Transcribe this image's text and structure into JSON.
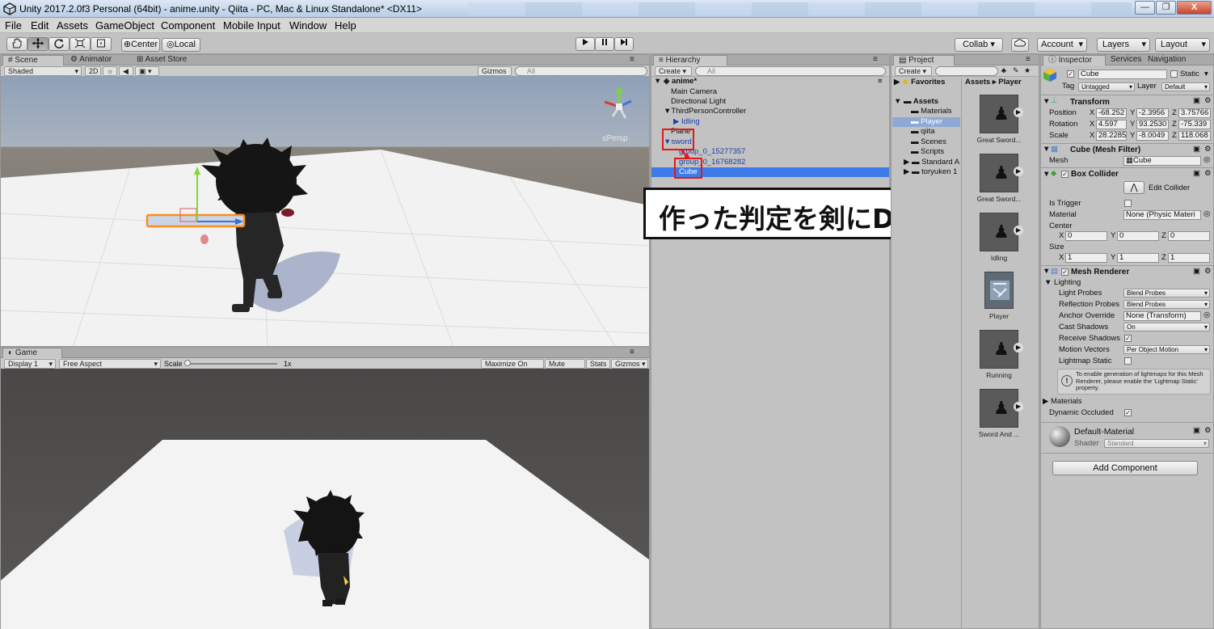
{
  "window": {
    "title": "Unity 2017.2.0f3 Personal (64bit) - anime.unity - Qiita - PC, Mac & Linux Standalone* <DX11>",
    "minimize": "—",
    "maximize": "❐",
    "close": "X"
  },
  "menu": [
    "File",
    "Edit",
    "Assets",
    "GameObject",
    "Component",
    "Mobile Input",
    "Window",
    "Help"
  ],
  "toolbar": {
    "pivot": "Center",
    "space": "Local",
    "collab": "Collab ▾",
    "account": "Account",
    "layers": "Layers",
    "layout": "Layout"
  },
  "scene": {
    "tabs": [
      "Scene",
      "Animator",
      "Asset Store"
    ],
    "shading": "Shaded",
    "mode_2d": "2D",
    "gizmos": "Gizmos",
    "search_placeholder": "All",
    "persp": "Persp"
  },
  "game": {
    "tab": "Game",
    "display": "Display 1",
    "aspect": "Free Aspect",
    "scale_label": "Scale",
    "scale_value": "1x",
    "maximize": "Maximize On Play",
    "mute": "Mute Audio",
    "stats": "Stats",
    "gizmos": "Gizmos"
  },
  "hierarchy": {
    "tab": "Hierarchy",
    "create": "Create",
    "search_placeholder": "All",
    "rows": [
      {
        "label": "anime*",
        "indent": 0,
        "style": "scene"
      },
      {
        "label": "Main Camera",
        "indent": 1,
        "style": "normal"
      },
      {
        "label": "Directional Light",
        "indent": 1,
        "style": "normal"
      },
      {
        "label": "ThirdPersonController",
        "indent": 1,
        "style": "normal"
      },
      {
        "label": "Idling",
        "indent": 2,
        "style": "blue"
      },
      {
        "label": "Plane",
        "indent": 1,
        "style": "normal"
      },
      {
        "label": "sword",
        "indent": 1,
        "style": "blue"
      },
      {
        "label": "group_0_15277357",
        "indent": 2,
        "style": "blue"
      },
      {
        "label": "group_0_16768282",
        "indent": 2,
        "style": "blue"
      },
      {
        "label": "Cube",
        "indent": 2,
        "style": "selected"
      }
    ]
  },
  "annotation": "作った判定を剣にD&D",
  "project": {
    "tab": "Project",
    "create": "Create",
    "favorites": "Favorites",
    "assets_root": "Assets",
    "breadcrumb_assets": "Assets",
    "breadcrumb_sep": "▸",
    "breadcrumb_current": "Player",
    "folders": [
      "Materials",
      "Player",
      "qiita",
      "Scenes",
      "Scripts",
      "Standard A",
      "toryuken 1"
    ],
    "assets": [
      "Great Sword...",
      "Great Sword...",
      "Idling",
      "Player",
      "Running",
      "Sword And ..."
    ]
  },
  "inspector": {
    "tabs": [
      "Inspector",
      "Services",
      "Navigation"
    ],
    "object_name": "Cube",
    "static_label": "Static",
    "tag_label": "Tag",
    "tag_value": "Untagged",
    "layer_label": "Layer",
    "layer_value": "Default",
    "transform": {
      "title": "Transform",
      "position_label": "Position",
      "position": [
        "-68.252",
        "-2.3956",
        "3.75766"
      ],
      "rotation_label": "Rotation",
      "rotation": [
        "4.597",
        "93.2530",
        "-75.339"
      ],
      "scale_label": "Scale",
      "scale": [
        "28.2285",
        "-8.0049",
        "118.068"
      ]
    },
    "mesh_filter": {
      "title": "Cube (Mesh Filter)",
      "mesh_label": "Mesh",
      "mesh_value": "Cube"
    },
    "box_collider": {
      "title": "Box Collider",
      "edit": "Edit Collider",
      "is_trigger": "Is Trigger",
      "material_label": "Material",
      "material_value": "None (Physic Materi",
      "center_label": "Center",
      "center": [
        "0",
        "0",
        "0"
      ],
      "size_label": "Size",
      "size": [
        "1",
        "1",
        "1"
      ]
    },
    "mesh_renderer": {
      "title": "Mesh Renderer",
      "lighting": "Lighting",
      "light_probes_label": "Light Probes",
      "light_probes": "Blend Probes",
      "reflection_probes_label": "Reflection Probes",
      "reflection_probes": "Blend Probes",
      "anchor_override_label": "Anchor Override",
      "anchor_override": "None (Transform)",
      "cast_shadows_label": "Cast Shadows",
      "cast_shadows": "On",
      "receive_shadows_label": "Receive Shadows",
      "motion_vectors_label": "Motion Vectors",
      "motion_vectors": "Per Object Motion",
      "lightmap_static_label": "Lightmap Static",
      "info": "To enable generation of lightmaps for this Mesh Renderer, please enable the 'Lightmap Static' property.",
      "materials": "Materials",
      "dynamic_occluded": "Dynamic Occluded"
    },
    "material": {
      "name": "Default-Material",
      "shader_label": "Shader",
      "shader_value": "Standard"
    },
    "add_component": "Add Component"
  },
  "colors": {
    "selection": "#3d7ce8",
    "annotation_border": "#e21818",
    "panel_bg": "#c2c2c2"
  }
}
